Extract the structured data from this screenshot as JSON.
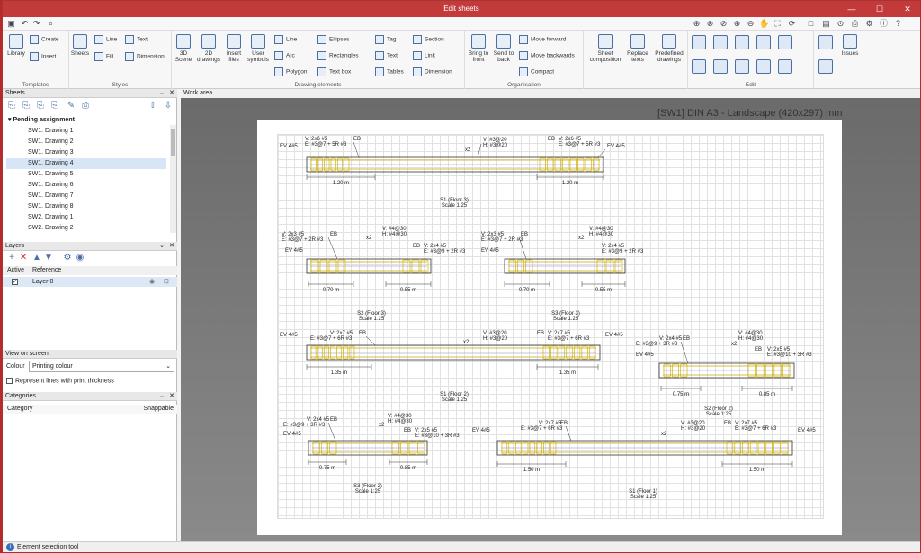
{
  "window": {
    "title": "Edit sheets"
  },
  "ribbon": {
    "templates": {
      "label": "Templates",
      "library": "Library",
      "create": "Create",
      "insert": "Insert"
    },
    "styles": {
      "label": "Styles",
      "sheets": "Sheets",
      "line": "Line",
      "fill": "Fill",
      "text": "Text",
      "dimension": "Dimension"
    },
    "drawing": {
      "label": "Drawing elements",
      "scene3d": "3D Scene",
      "drawings2d": "2D drawings",
      "insert_files": "Insert files",
      "user_symbols": "User symbols",
      "line": "Line",
      "arc": "Arc",
      "polygon": "Polygon",
      "ellipses": "Ellipses",
      "rectangles": "Rectangles",
      "text_box": "Text box",
      "tag": "Tag",
      "text": "Text",
      "tables": "Tables",
      "section": "Section",
      "link": "Link",
      "dimension": "Dimension"
    },
    "organisation": {
      "label": "Organisation",
      "bring_front": "Bring to front",
      "send_back": "Send to back",
      "move_forward": "Move forward",
      "move_backwards": "Move backwards",
      "compact": "Compact"
    },
    "sheetgrp": {
      "composition": "Sheet composition",
      "replace_texts": "Replace texts",
      "predefined": "Predefined drawings"
    },
    "edit": {
      "label": "Edit"
    },
    "issues": "Issues"
  },
  "sheets_panel": {
    "title": "Sheets",
    "group": "Pending assignment",
    "items": [
      "SW1. Drawing 1",
      "SW1. Drawing 2",
      "SW1. Drawing 3",
      "SW1. Drawing 4",
      "SW1. Drawing 5",
      "SW1. Drawing 6",
      "SW1. Drawing 7",
      "SW1. Drawing 8",
      "SW2. Drawing 1",
      "SW2. Drawing 2"
    ],
    "selected": "SW1. Drawing 4"
  },
  "layers_panel": {
    "title": "Layers",
    "col_active": "Active",
    "col_reference": "Reference",
    "layer": "Layer 0"
  },
  "view_panel": {
    "title": "View on screen",
    "colour_label": "Colour",
    "colour_value": "Printing colour",
    "thickness_label": "Represent lines with print thickness"
  },
  "categories_panel": {
    "title": "Categories",
    "col_category": "Category",
    "col_snappable": "Snappable"
  },
  "work_area": {
    "title": "Work area",
    "sheet_title": "[SW1] DIN A3 - Landscape (420x297) mm"
  },
  "status": "Element selection tool",
  "drawing": {
    "s1f3": {
      "title": "S1 (Floor 3)",
      "scale": "Scale 1:25",
      "left_top": "V: 2x6 #5",
      "left_bot": "E: #3@7 + 5R #3",
      "mid_top": "V: #3@20",
      "mid_bot": "H: #3@20",
      "right_top": "V: 2x6 #5",
      "right_bot": "E: #3@7 + 5R #3",
      "ev": "EV 4#5",
      "eb": "EB",
      "x2": "x2",
      "dim": "1.20 m"
    },
    "s2f3": {
      "title": "S2 (Floor 3)",
      "scale": "Scale 1:25",
      "l1": "V: 2x3 #5",
      "l2": "E: #3@7 + 2R #3",
      "m1": "V: #4@30",
      "m2": "H: #4@30",
      "r1": "V: 2x4 #5",
      "r2": "E: #3@9 + 2R #3",
      "d1": "0.70 m",
      "d2": "0.55 m"
    },
    "s3f3": {
      "title": "S3 (Floor 3)",
      "scale": "Scale 1:25",
      "l1": "V: 2x3 #5",
      "l2": "E: #3@7 + 2R #3",
      "m1": "V: #4@30",
      "m2": "H: #4@30",
      "r1": "V: 2x4 #5",
      "r2": "E: #3@9 + 2R #3",
      "d1": "0.70 m",
      "d2": "0.55 m"
    },
    "s1f2": {
      "title": "S1 (Floor 2)",
      "scale": "Scale 1:25",
      "l1": "V: 2x7 #5",
      "l2": "E: #3@7 + 6R #3",
      "m1": "V: #3@20",
      "m2": "H: #3@20",
      "r1": "V: 2x7 #5",
      "r2": "E: #3@7 + 6R #3",
      "dim": "1.35 m"
    },
    "s2f2": {
      "title": "S2 (Floor 2)",
      "scale": "Scale 1:25",
      "l1": "V: 2x4 #5",
      "l2": "E: #3@9 + 3R #3",
      "m1": "V: #4@30",
      "m2": "H: #4@30",
      "r1": "V: 2x5 #5",
      "r2": "E: #3@10 + 3R #3",
      "d1": "0.75 m",
      "d2": "0.85 m"
    },
    "s3f2": {
      "title": "S3 (Floor 2)",
      "scale": "Scale 1:25",
      "l1": "V: 2x4 #5",
      "l2": "E: #3@9 + 3R #3",
      "m1": "V: #4@30",
      "m2": "H: #4@30",
      "r1": "V: 2x5 #5",
      "r2": "E: #3@10 + 3R #3",
      "d1": "0.75 m",
      "d2": "0.85 m"
    },
    "s1f1": {
      "title": "S1 (Floor 1)",
      "scale": "Scale 1:25",
      "l1": "V: 2x7 #5",
      "l2": "E: #3@7 + 6R #3",
      "m1": "V: #3@20",
      "m2": "H: #3@20",
      "r1": "V: 2x7 #5",
      "r2": "E: #3@7 + 6R #3",
      "dim": "1.50 m"
    }
  }
}
